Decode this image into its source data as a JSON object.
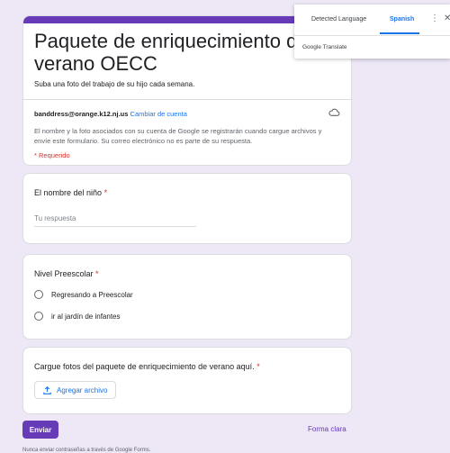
{
  "form": {
    "title": "Paquete de enriquecimiento de verano OECC",
    "description": "Suba una foto del trabajo de su hijo cada semana.",
    "account_email": "banddress@orange.k12.nj.us",
    "switch_account": "Cambiar de cuenta",
    "notice": "El nombre y la foto asociados con su cuenta de Google se registrarán cuando cargue archivos y envíe este formulario. Su correo electrónico no es parte de su respuesta.",
    "required_label": "* Requerido",
    "questions": {
      "name": {
        "title": "El nombre del niño",
        "star": "*",
        "placeholder": "Tu respuesta"
      },
      "level": {
        "title": "Nivel Preescolar",
        "star": "*",
        "options": [
          "Regresando a Preescolar",
          "ir al jardín de infantes"
        ]
      },
      "upload": {
        "title": "Cargue fotos del paquete de enriquecimiento de verano aquí.",
        "star": "*",
        "button": "Agregar archivo"
      }
    },
    "submit": "Enviar",
    "clear": "Forma clara",
    "footer": "Nunca enviar contraseñas a través de Google Forms."
  },
  "translate": {
    "detected": "Detected Language",
    "target": "Spanish",
    "brand": "Google Translate"
  },
  "colors": {
    "accent": "#673ab7",
    "background": "#ede7f6",
    "required": "#d93025",
    "link": "#1a73e8"
  }
}
